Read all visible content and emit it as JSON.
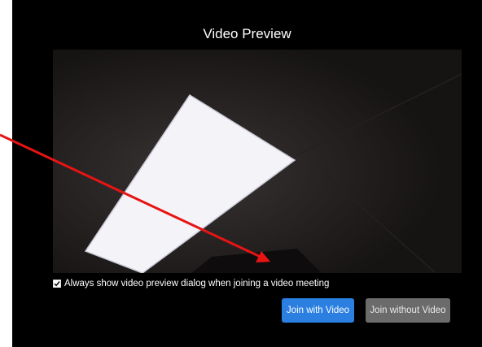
{
  "dialog": {
    "title": "Video Preview",
    "checkbox": {
      "label": "Always show video preview dialog when joining a video meeting",
      "checked": true
    },
    "buttons": {
      "join_with_video": "Join with Video",
      "join_without_video": "Join without Video"
    },
    "colors": {
      "background": "#000000",
      "primary_button": "#2a7fe0",
      "secondary_button": "#6b6b6b"
    }
  },
  "annotation": {
    "color": "#e81414"
  }
}
